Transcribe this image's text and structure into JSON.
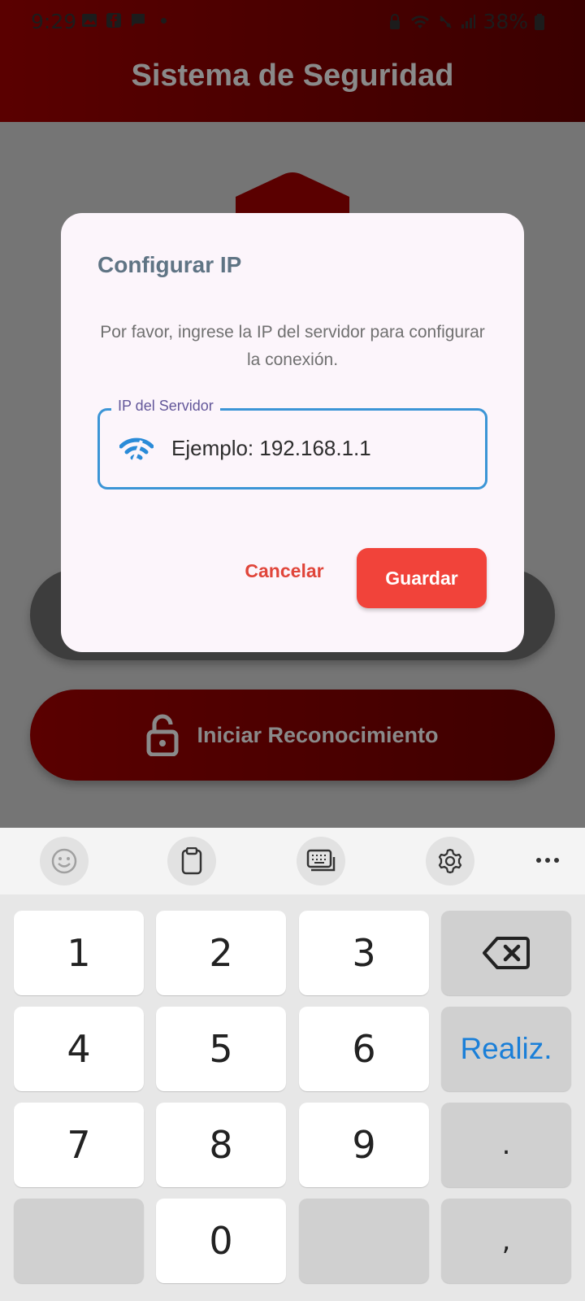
{
  "status_bar": {
    "time": "9:29",
    "battery": "38%"
  },
  "app_bar": {
    "title": "Sistema de Seguridad"
  },
  "main": {
    "start_button_label": "Iniciar Reconocimiento"
  },
  "dialog": {
    "title": "Configurar IP",
    "message": "Por favor, ingrese la IP del servidor para configurar la conexión.",
    "field_label": "IP del Servidor",
    "field_placeholder": "Ejemplo: 192.168.1.1",
    "cancel_label": "Cancelar",
    "save_label": "Guardar"
  },
  "keyboard": {
    "keys": [
      "1",
      "2",
      "3",
      "4",
      "5",
      "6",
      "Realiz.",
      "7",
      "8",
      "9",
      ".",
      "0",
      ","
    ]
  },
  "colors": {
    "app_bar": "#5a0000",
    "accent_red": "#f1433a",
    "field_border": "#3b95d6",
    "done_key": "#1a7fd8"
  }
}
